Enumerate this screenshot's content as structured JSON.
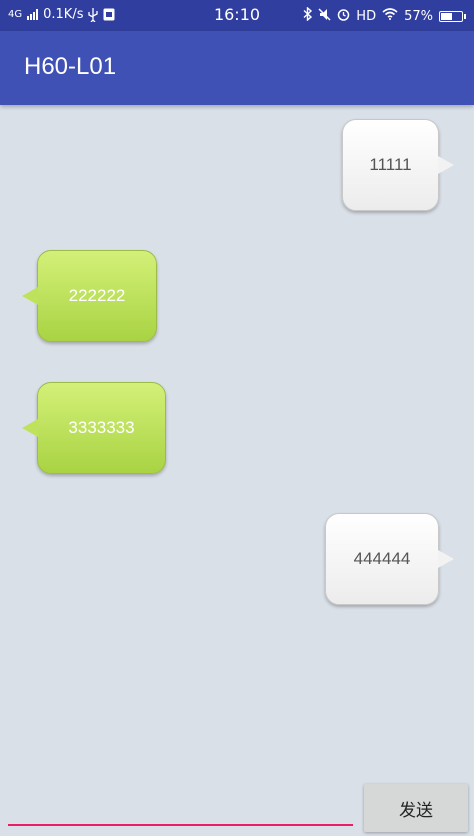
{
  "status_bar": {
    "network": "4G",
    "speed": "0.1K/s",
    "time": "16:10",
    "hd": "HD",
    "battery": "57%",
    "battery_level": 0.57
  },
  "app_bar": {
    "title": "H60-L01"
  },
  "messages": [
    {
      "side": "right",
      "text": "11111"
    },
    {
      "side": "left",
      "text": "222222"
    },
    {
      "side": "left",
      "text": "3333333"
    },
    {
      "side": "right",
      "text": "444444"
    }
  ],
  "composer": {
    "input_value": "",
    "send_label": "发送"
  },
  "colors": {
    "status_bar": "#303f9f",
    "app_bar": "#3f51b5",
    "chat_background": "#dae0e8",
    "left_bubble": "#bfe25c",
    "right_bubble": "#f2f2f2",
    "input_underline": "#e91e63"
  }
}
